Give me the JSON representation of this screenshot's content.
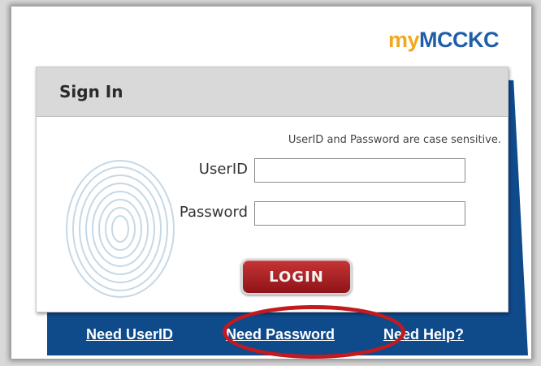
{
  "logo": {
    "prefix": "my",
    "brand": "MCCKC"
  },
  "signin": {
    "title": "Sign In",
    "note": "UserID and Password are case sensitive.",
    "userid_label": "UserID",
    "userid_value": "",
    "password_label": "Password",
    "password_value": "",
    "login_label": "LOGIN"
  },
  "links": {
    "need_userid": "Need UserID",
    "need_password": "Need Password",
    "need_help": "Need Help?"
  },
  "colors": {
    "brand_blue": "#0f4a8a",
    "accent_orange": "#f2a81d",
    "login_red": "#a31c1f",
    "highlight_red": "#c21a1f"
  },
  "icons": [
    "fingerprint-icon"
  ]
}
